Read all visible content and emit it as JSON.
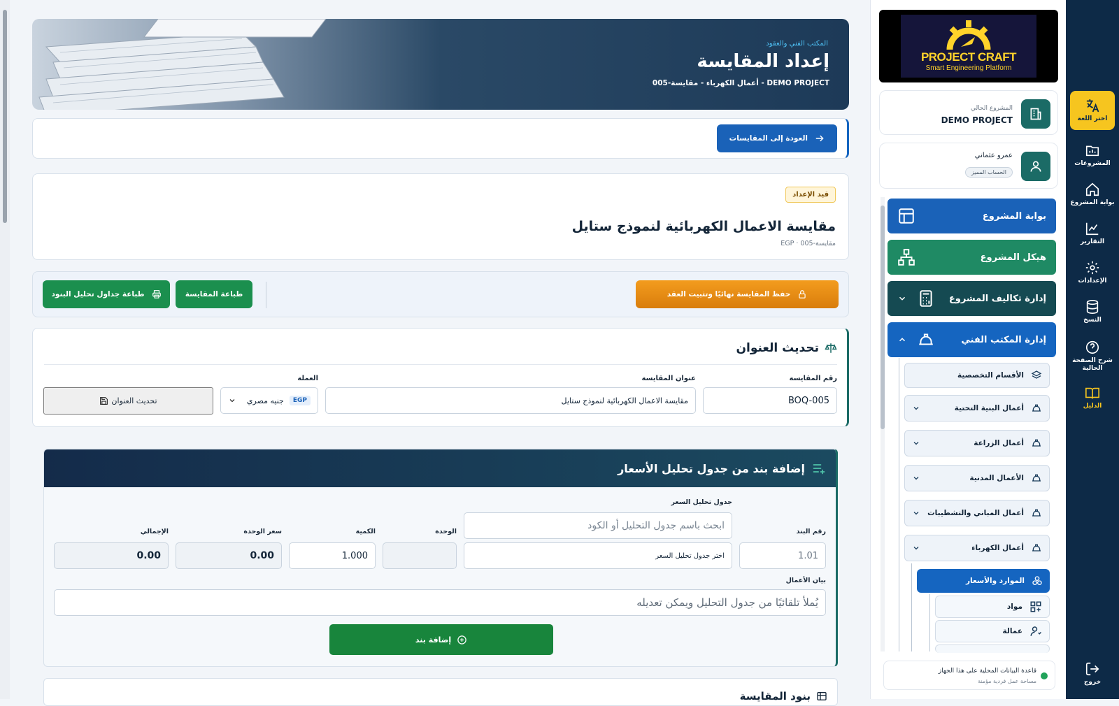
{
  "header": {
    "department": "المكتب الفني والعقود",
    "title": "إعداد المقايسة",
    "breadcrumb": "DEMO PROJECT - أعمال الكهرباء - مقايسة-005"
  },
  "back_button": "العودة إلى المقايسات",
  "boq": {
    "status_badge": "قيد الإعداد",
    "title": "مقايسة الاعمال الكهربائية لنموذج ستايل",
    "meta": "مقايسة-005 · EGP"
  },
  "actions": {
    "finalize": "حفظ المقايسة نهائيًا وتثبيت العقد",
    "print_boq": "طباعة المقايسة",
    "print_analysis": "طباعة جداول تحليل البنود"
  },
  "title_update": {
    "heading": "تحديث العنوان",
    "number_label": "رقم المقايسة",
    "number_value": "BOQ-005",
    "title_label": "عنوان المقايسة",
    "title_value": "مقايسة الاعمال الكهربائية لنموذج ستايل",
    "currency_label": "العملة",
    "currency_code": "EGP",
    "currency_name": "جنيه مصري",
    "update_button": "تحديث العنوان"
  },
  "add_item": {
    "heading": "إضافة بند من جدول تحليل الأسعار",
    "analysis_label": "جدول تحليل السعر",
    "analysis_search_placeholder": "ابحث باسم جدول التحليل أو الكود",
    "analysis_select_placeholder": "اختر جدول تحليل السعر",
    "item_no_label": "رقم البند",
    "item_no_value": "1.01",
    "unit_label": "الوحدة",
    "unit_value": "",
    "qty_label": "الكمية",
    "qty_value": "1.000",
    "unit_price_label": "سعر الوحدة",
    "unit_price_value": "0.00",
    "total_label": "الإجمالي",
    "total_value": "0.00",
    "desc_label": "بيان الأعمال",
    "desc_placeholder": "يُملأ تلقائيًا من جدول التحليل ويمكن تعديله",
    "add_button": "إضافة بند"
  },
  "next_section": "بنود المقايسة",
  "sidebar": {
    "logo_title": "PROJECT CRAFT",
    "logo_sub": "Smart Engineering Platform",
    "current_project_label": "المشروع الحالي",
    "current_project": "DEMO PROJECT",
    "user_name": "عمرو عثماني",
    "user_badge": "الحساب المميز",
    "nav": [
      {
        "label": "بوابة المشروع"
      },
      {
        "label": "هيكل المشروع"
      },
      {
        "label": "إدارة تكاليف المشروع"
      },
      {
        "label": "إدارة المكتب الفني"
      }
    ],
    "subitems": [
      {
        "label": "الأقسام التخصصية"
      },
      {
        "label": "أعمال البنية التحتية"
      },
      {
        "label": "أعمال الزراعة"
      },
      {
        "label": "الأعمال المدنية"
      },
      {
        "label": "أعمال المباني والتشطيبات"
      },
      {
        "label": "أعمال الكهرباء"
      }
    ],
    "selected": "الموارد والأسعار",
    "leaves": [
      {
        "label": "مواد"
      },
      {
        "label": "عمالة"
      }
    ],
    "db_status": "قاعدة البيانات المحلية على هذا الجهاز",
    "db_status_sub": "مساحة عمل فردية مؤمنة"
  },
  "rail": {
    "language": "اختر اللغة",
    "projects": "المشروعات",
    "portal": "بوابة المشروع",
    "reports": "التقارير",
    "settings": "الإعدادات",
    "backup": "النسخ",
    "help": "شرح الصفحة الحالية",
    "guide": "الدليل",
    "logout": "خروج"
  },
  "colors": {
    "navy": "#0d2a47",
    "blue": "#1565c0",
    "teal": "#1b6b66",
    "green": "#1b8f4e",
    "orange": "#f39c1e",
    "yellow": "#f6c51f"
  }
}
